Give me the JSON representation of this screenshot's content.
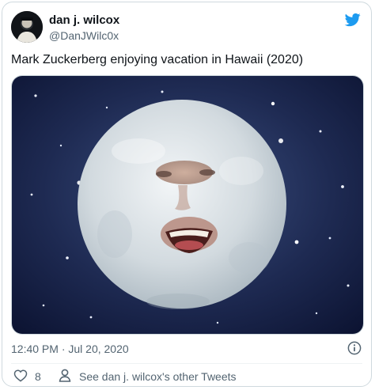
{
  "tweet": {
    "author_name": "dan j. wilcox",
    "author_handle": "@DanJWilc0x",
    "text": "Mark Zuckerberg enjoying vacation in Hawaii (2020)",
    "timestamp": "12:40 PM · Jul 20, 2020",
    "like_count": "8",
    "other_tweets_label": "See dan j. wilcox's other Tweets"
  },
  "icons": {
    "brand": "twitter-bird-icon",
    "info": "info-icon",
    "like": "heart-icon",
    "profile": "person-icon"
  },
  "colors": {
    "brand_blue": "#1d9bf0",
    "text_primary": "#0f1419",
    "text_secondary": "#536471",
    "border": "#cfd9de"
  }
}
